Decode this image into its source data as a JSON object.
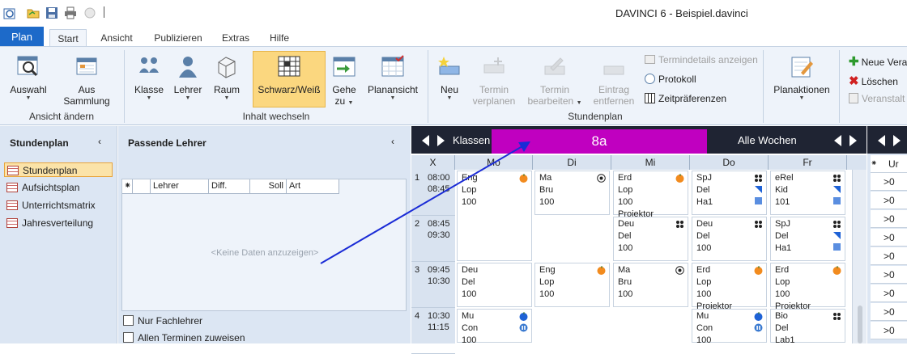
{
  "app": {
    "title": "DAVINCI 6 - Beispiel.davinci",
    "plan_tab": "Plan"
  },
  "tabs": [
    "Start",
    "Ansicht",
    "Publizieren",
    "Extras",
    "Hilfe"
  ],
  "ribbon": {
    "group1": {
      "label": "Ansicht ändern",
      "auswahl": "Auswahl",
      "aus": "Aus",
      "sammlung": "Sammlung"
    },
    "group2": {
      "label": "Inhalt wechseln",
      "klasse": "Klasse",
      "lehrer": "Lehrer",
      "raum": "Raum",
      "schwarz": "Schwarz/Weiß",
      "gehe": "Gehe",
      "zu": "zu",
      "planansicht": "Planansicht"
    },
    "group3": {
      "label": "Stundenplan",
      "neu": "Neu",
      "termin1": "Termin",
      "verplanen": "verplanen",
      "termin2": "Termin",
      "bearbeiten": "bearbeiten",
      "eintrag": "Eintrag",
      "entfernen": "entfernen",
      "termindetails": "Termindetails anzeigen",
      "protokoll": "Protokoll",
      "zeitpraeferenzen": "Zeitpräferenzen"
    },
    "group4": {
      "planaktionen": "Planaktionen",
      "neue_veranst": "Neue Vera",
      "loeschen": "Löschen",
      "veranstalt": "Veranstalt"
    }
  },
  "left_panel": {
    "header": "Stundenplan",
    "items": [
      "Stundenplan",
      "Aufsichtsplan",
      "Unterrichtsmatrix",
      "Jahresverteilung"
    ]
  },
  "mid_panel": {
    "header": "Passende Lehrer",
    "columns": [
      "Lehrer",
      "Diff.",
      "Soll",
      "Art"
    ],
    "empty": "<Keine Daten anzuzeigen>",
    "check1": "Nur Fachlehrer",
    "check2": "Allen Terminen zuweisen"
  },
  "schedule": {
    "nav_label": "Klassen",
    "class_name": "8a",
    "weeks": "Alle Wochen",
    "corner": "X",
    "days": [
      "Mo",
      "Di",
      "Mi",
      "Do",
      "Fr"
    ],
    "periods": [
      {
        "n": "1",
        "start": "08:00",
        "end": "08:45"
      },
      {
        "n": "2",
        "start": "08:45",
        "end": "09:30"
      },
      {
        "n": "3",
        "start": "09:45",
        "end": "10:30"
      },
      {
        "n": "4",
        "start": "10:30",
        "end": "11:15"
      }
    ],
    "cells": {
      "mo1": [
        "Eng",
        "Lop",
        "100"
      ],
      "mo3": [
        "Deu",
        "Del",
        "100"
      ],
      "mo4": [
        "Mu",
        "Con",
        "100"
      ],
      "di1": [
        "Ma",
        "Bru",
        "100"
      ],
      "di3": [
        "Eng",
        "Lop",
        "100"
      ],
      "mi1": [
        "Erd",
        "Lop",
        "100",
        "Projektor"
      ],
      "mi2": [
        "Deu",
        "Del",
        "100"
      ],
      "mi3": [
        "Ma",
        "Bru",
        "100"
      ],
      "do1": [
        "SpJ",
        "Del",
        "Ha1"
      ],
      "do2": [
        "Deu",
        "Del",
        "100"
      ],
      "do3": [
        "Erd",
        "Lop",
        "100",
        "Projektor"
      ],
      "do4": [
        "Mu",
        "Con",
        "100"
      ],
      "fr1": [
        "eRel",
        "Kid",
        "101"
      ],
      "fr2": [
        "SpJ",
        "Del",
        "Ha1"
      ],
      "fr3": [
        "Erd",
        "Lop",
        "100",
        "Projektor"
      ],
      "fr4": [
        "Bio",
        "Del",
        "Lab1"
      ]
    }
  },
  "right_panel": {
    "header": "Ur",
    "rows": [
      ">0",
      ">0",
      ">0",
      ">0",
      ">0",
      ">0",
      ">0",
      ">0",
      ">0"
    ]
  },
  "colors": {
    "accent": "#1d6ac9",
    "class_bar": "#c000c0",
    "sched_header": "#1f2433",
    "arrow": "#1a2bd6"
  }
}
